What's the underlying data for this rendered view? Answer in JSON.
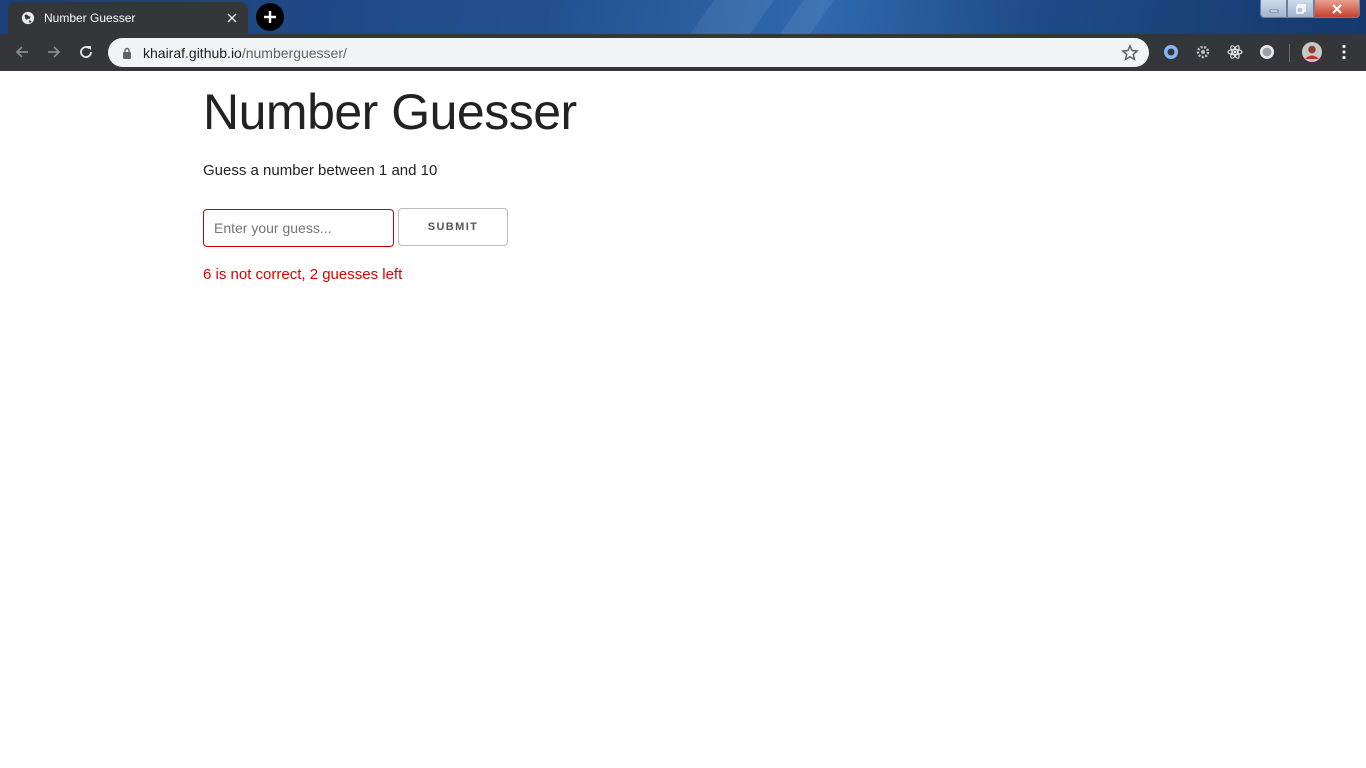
{
  "browser": {
    "tab": {
      "title": "Number Guesser",
      "favicon": "globe-icon"
    },
    "address_bar": {
      "host": "khairaf.github.io",
      "path": "/numberguesser/"
    },
    "extensions": [
      "extension-ring-icon",
      "extension-gear-icon",
      "react-devtools-icon",
      "extension-circle-icon"
    ],
    "window_controls": [
      "minimize",
      "restore",
      "close"
    ]
  },
  "page": {
    "title": "Number Guesser",
    "instructions": "Guess a number between 1 and 10",
    "guess_input": {
      "value": "",
      "placeholder": "Enter your guess..."
    },
    "submit_label": "SUBMIT",
    "message": "6 is not correct, 2 guesses left"
  },
  "colors": {
    "message": "#dd0000",
    "input_border": "#cc0000",
    "toolbar": "#35363a"
  }
}
